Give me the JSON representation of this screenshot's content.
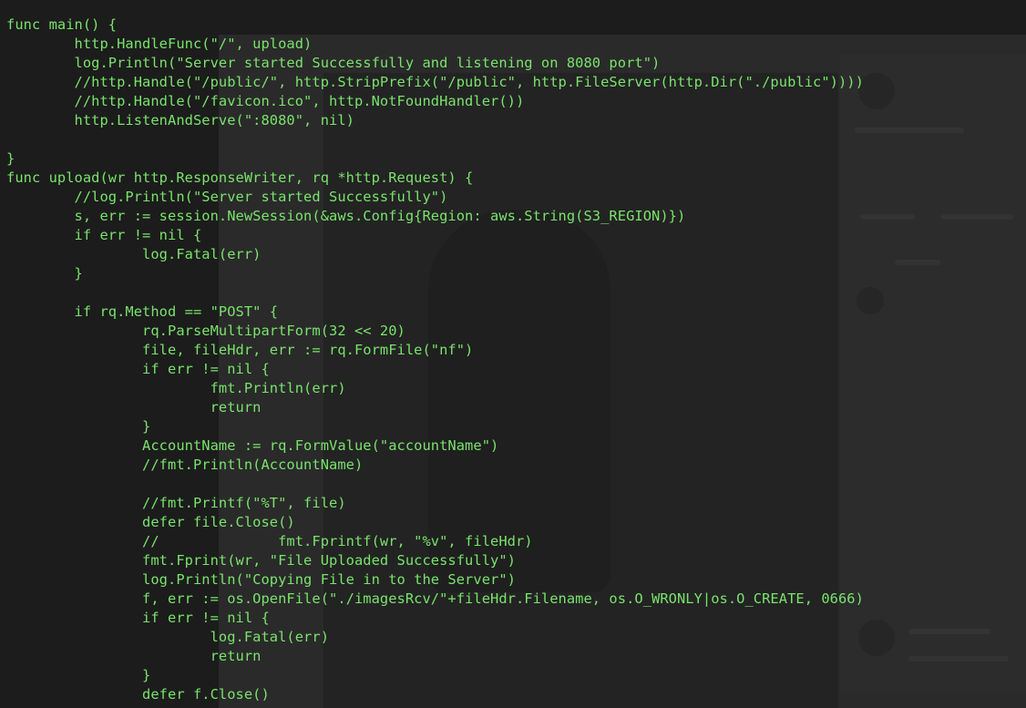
{
  "colors": {
    "terminal_text": "#79e36b",
    "terminal_bg": "#1c1c1c"
  },
  "terminal": {
    "lines": [
      "func main() {",
      "        http.HandleFunc(\"/\", upload)",
      "        log.Println(\"Server started Successfully and listening on 8080 port\")",
      "        //http.Handle(\"/public/\", http.StripPrefix(\"/public\", http.FileServer(http.Dir(\"./public\"))))",
      "        //http.Handle(\"/favicon.ico\", http.NotFoundHandler())",
      "        http.ListenAndServe(\":8080\", nil)",
      "",
      "}",
      "func upload(wr http.ResponseWriter, rq *http.Request) {",
      "        //log.Println(\"Server started Successfully\")",
      "        s, err := session.NewSession(&aws.Config{Region: aws.String(S3_REGION)})",
      "        if err != nil {",
      "                log.Fatal(err)",
      "        }",
      "",
      "        if rq.Method == \"POST\" {",
      "                rq.ParseMultipartForm(32 << 20)",
      "                file, fileHdr, err := rq.FormFile(\"nf\")",
      "                if err != nil {",
      "                        fmt.Println(err)",
      "                        return",
      "                }",
      "                AccountName := rq.FormValue(\"accountName\")",
      "                //fmt.Println(AccountName)",
      "",
      "                //fmt.Printf(\"%T\", file)",
      "                defer file.Close()",
      "                //              fmt.Fprintf(wr, \"%v\", fileHdr)",
      "                fmt.Fprint(wr, \"File Uploaded Successfully\")",
      "                log.Println(\"Copying File in to the Server\")",
      "                f, err := os.OpenFile(\"./imagesRcv/\"+fileHdr.Filename, os.O_WRONLY|os.O_CREATE, 0666)",
      "                if err != nil {",
      "                        log.Fatal(err)",
      "                        return",
      "                }",
      "                defer f.Close()"
    ]
  }
}
